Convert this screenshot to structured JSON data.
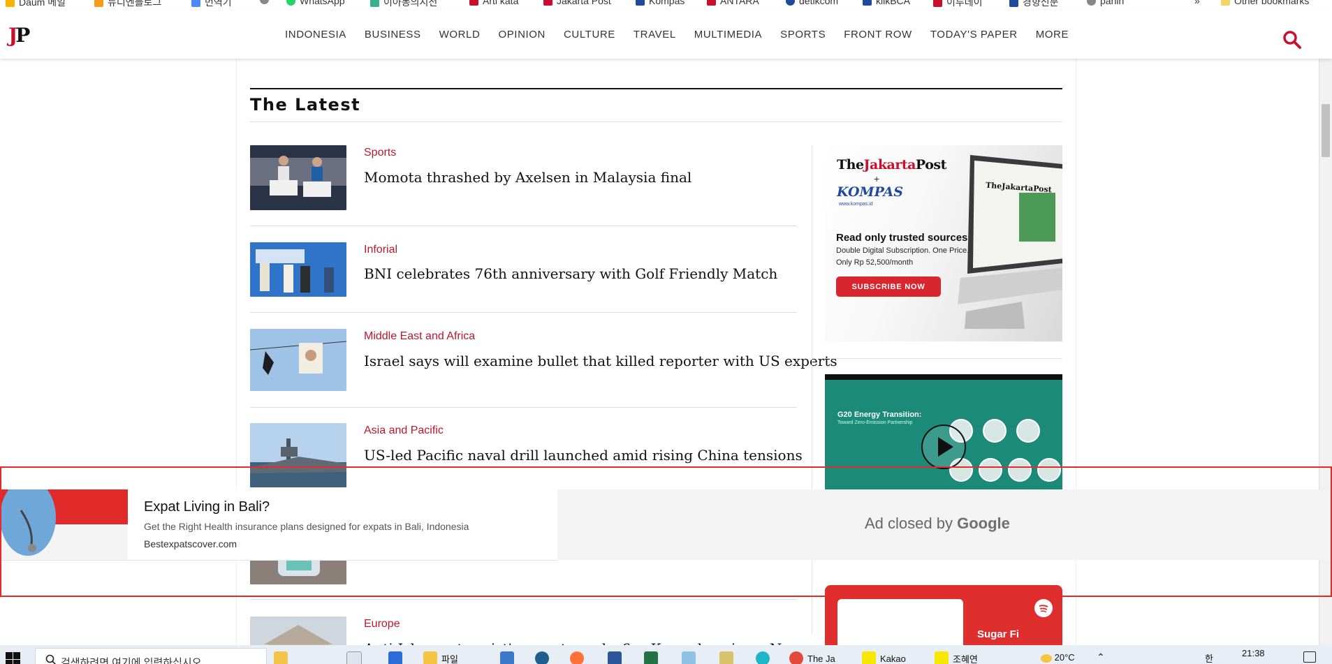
{
  "bookmarks": [
    {
      "label": "Daum 메일",
      "color": "#f5b400"
    },
    {
      "label": "뉴디엔플로그",
      "color": "#f59e1b"
    },
    {
      "label": "번역기",
      "color": "#4a8af4"
    },
    {
      "label": "",
      "color": "#888888"
    },
    {
      "label": "WhatsApp",
      "color": "#25d366"
    },
    {
      "label": "이아동의시전",
      "color": "#3cb08a"
    },
    {
      "label": "Arti kata",
      "color": "#c8102e"
    },
    {
      "label": "Jakarta Post",
      "color": "#c8102e"
    },
    {
      "label": "Kompas",
      "color": "#1f4a9e"
    },
    {
      "label": "ANTARA",
      "color": "#c8102e"
    },
    {
      "label": "detikcom",
      "color": "#1f4a9e"
    },
    {
      "label": "klikBCA",
      "color": "#1f4a9e"
    },
    {
      "label": "이투데이",
      "color": "#c8102e"
    },
    {
      "label": "경향신문",
      "color": "#1f4a9e"
    },
    {
      "label": "panin",
      "color": "#888888"
    }
  ],
  "bookmarks_more": "»",
  "other_bookmarks": "Other bookmarks",
  "header": {
    "logo_j": "J",
    "logo_p": "P",
    "nav": [
      "INDONESIA",
      "BUSINESS",
      "WORLD",
      "OPINION",
      "CULTURE",
      "TRAVEL",
      "MULTIMEDIA",
      "SPORTS",
      "FRONT ROW",
      "TODAY'S PAPER",
      "MORE"
    ],
    "search_icon": "search-icon"
  },
  "section": {
    "title": "The Latest"
  },
  "articles": [
    {
      "category": "Sports",
      "headline": "Momota thrashed by Axelsen in Malaysia final"
    },
    {
      "category": "Inforial",
      "headline": "BNI celebrates 76th anniversary with Golf Friendly Match"
    },
    {
      "category": "Middle East and Africa",
      "headline": "Israel says will examine bullet that killed reporter with US experts"
    },
    {
      "category": "Asia and Pacific",
      "headline": "US-led Pacific naval drill launched amid rising China tensions"
    },
    {
      "category": "Europe",
      "headline": "Anti-Islam extremist's arrest sparks fire Koran burnings, N"
    }
  ],
  "promo": {
    "brand1_a": "The",
    "brand1_b": "Jakarta",
    "brand1_c": "Post",
    "plus": "+",
    "brand2": "KOMPAS",
    "url": "www.kompas.id",
    "headline": "Read only trusted sources",
    "line1": "Double Digital Subscription. One Price.",
    "line2": "Only Rp 52,500/month",
    "cta": "SUBSCRIBE NOW",
    "laptop_brand": "TheJakartaPost"
  },
  "video": {
    "title": "G20 Energy Transition:",
    "subtitle": "Toward Zero-Emission Partnership"
  },
  "spotify": {
    "title": "Sugar Fi"
  },
  "sticky_ad": {
    "title": "Expat Living in Bali?",
    "description": "Get the Right Health insurance plans designed for expats in Bali, Indonesia",
    "domain": "Bestexpatscover.com",
    "closed_prefix": "Ad closed by",
    "closed_brand": "Google"
  },
  "taskbar": {
    "search_placeholder": "검색하려면 여기에 입력하십시오",
    "apps": [
      {
        "label": "파일",
        "color": "#f5c542"
      },
      {
        "label": "The Ja",
        "color": "#4a8af4"
      },
      {
        "label": "Kakao",
        "color": "#f7e600"
      },
      {
        "label": "조혜연",
        "color": "#f7e600"
      }
    ],
    "weather": "20°C",
    "time": "21:38",
    "ime": "한"
  }
}
